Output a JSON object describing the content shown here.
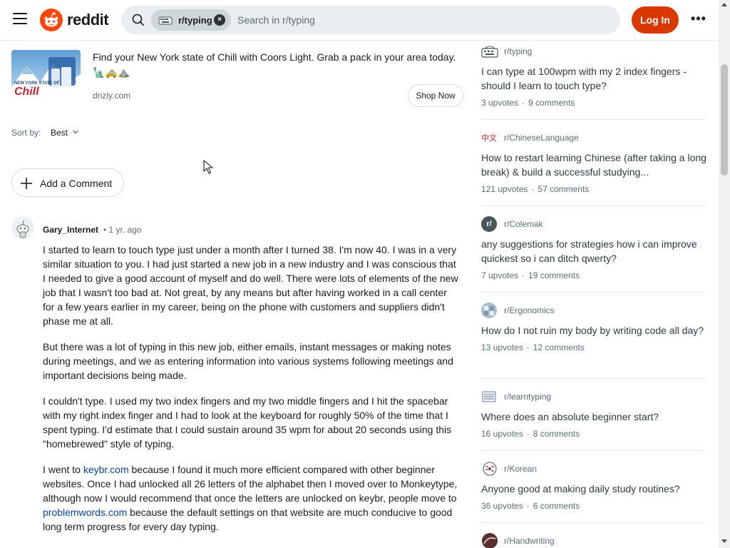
{
  "header": {
    "logo_text": "reddit",
    "search_chip": "r/typing",
    "search_placeholder": "Search in r/typing",
    "login_label": "Log In",
    "more_label": "•••"
  },
  "ad": {
    "image_caption": "NEW YORK STATE OF",
    "image_brand": "Chill",
    "text": "Find your New York state of Chill with Coors Light. Grab a pack in your area today. 🗽🚕⛰️",
    "domain": "drizly.com",
    "cta": "Shop Now"
  },
  "sort": {
    "label": "Sort by:",
    "value": "Best"
  },
  "add_comment_label": "Add a Comment",
  "comment": {
    "author": "Gary_Internet",
    "time": "• 1 yr. ago",
    "paragraphs": [
      "I started to learn to touch type just under a month after I turned 38. I'm now 40. I was in a very similar situation to you. I had just started a new job in a new industry and I was conscious that I needed to give a good account of myself and do well. There were lots of elements of the new job that I wasn't too bad at. Not great, by any means but after having worked in a call center for a few years earlier in my career, being on the phone with customers and suppliers didn't phase me at all.",
      "But there was a lot of typing in this new job, either emails, instant messages or making notes during meetings, and we as entering information into various systems following meetings and important decisions being made.",
      "I couldn't type. I used my two index fingers and my two middle fingers and I hit the spacebar with my right index finger and I had to look at the keyboard for roughly 50% of the time that I spent typing. I'd estimate that I could sustain around 35 wpm for about 20 seconds using this \"homebrewed\" style of typing."
    ],
    "p4_part1": "I went to ",
    "p4_link1": "keybr.com",
    "p4_part2": " because I found it much more efficient compared with other beginner websites. Once I had unlocked all 26 letters of the alphabet then I moved over to Monkeytype, although now I would recommend that once the letters are unlocked on keybr, people move to ",
    "p4_link2": "problemwords.com",
    "p4_part3": " because the default settings on that website are much conducive to good long term progress for every day typing."
  },
  "sidebar": {
    "posts": [
      {
        "sub": "r/typing",
        "title": "I can type at 100wpm with my 2 index fingers - should I learn to touch type?",
        "upvotes": "3 upvotes",
        "comments": "9 comments"
      },
      {
        "sub": "r/ChineseLanguage",
        "title": "How to restart learning Chinese (after taking a long break) & build a successful studying...",
        "upvotes": "121 upvotes",
        "comments": "57 comments"
      },
      {
        "sub": "r/Colemak",
        "title": "any suggestions for strategies how i can improve quickest so i can ditch qwerty?",
        "upvotes": "7 upvotes",
        "comments": "19 comments"
      },
      {
        "sub": "r/Ergonomics",
        "title": "How do I not ruin my body by writing code all day?",
        "upvotes": "13 upvotes",
        "comments": "12 comments"
      },
      {
        "sub": "r/learntyping",
        "title": "Where does an absolute beginner start?",
        "upvotes": "16 upvotes",
        "comments": "8 comments"
      },
      {
        "sub": "r/Korean",
        "title": "Anyone good at making daily study routines?",
        "upvotes": "36 upvotes",
        "comments": "6 comments"
      },
      {
        "sub": "r/Handwriting",
        "title": "",
        "upvotes": "",
        "comments": ""
      }
    ],
    "chinese_icon_text": "中文",
    "colemak_icon_text": "r/"
  },
  "colors": {
    "brand_orange": "#ff4500",
    "login_bg": "#d93900",
    "link": "#0a449b"
  }
}
